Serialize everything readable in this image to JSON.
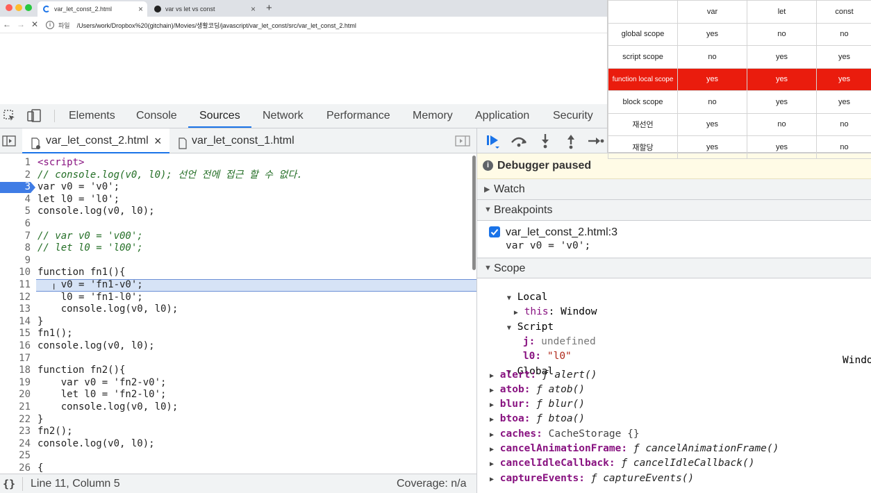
{
  "browser": {
    "tabs": [
      {
        "title": "var_let_const_2.html",
        "active": true
      },
      {
        "title": "var vs let vs const",
        "active": false
      }
    ],
    "new_tab": "+",
    "address_prefix": "파일",
    "url": "/Users/work/Dropbox%20(gitchain)/Movies/생활코딩/javascript/var_let_const/src/var_let_const_2.html"
  },
  "devtools": {
    "tabs": [
      "Elements",
      "Console",
      "Sources",
      "Network",
      "Performance",
      "Memory",
      "Application",
      "Security"
    ],
    "active_tab": "Sources"
  },
  "sources": {
    "files": [
      {
        "name": "var_let_const_2.html",
        "active": true
      },
      {
        "name": "var_let_const_1.html",
        "active": false
      }
    ]
  },
  "code": {
    "current_line": 3,
    "selected_line": 11,
    "lines": [
      "<script>",
      "// console.log(v0, l0); 선언 전에 접근 할 수 없다.",
      "var v0 = 'v0';",
      "let l0 = 'l0';",
      "console.log(v0, l0);",
      "",
      "// var v0 = 'v00';",
      "// let l0 = 'l00';",
      "",
      "function fn1(){",
      "    v0 = 'fn1-v0';",
      "    l0 = 'fn1-l0';",
      "    console.log(v0, l0);",
      "}",
      "fn1();",
      "console.log(v0, l0);",
      "",
      "function fn2(){",
      "    var v0 = 'fn2-v0';",
      "    let l0 = 'fn2-l0';",
      "    console.log(v0, l0);",
      "}",
      "fn2();",
      "console.log(v0, l0);",
      "",
      "{"
    ]
  },
  "status": {
    "braces": "{}",
    "position": "Line 11, Column 5",
    "coverage": "Coverage: n/a"
  },
  "debugger": {
    "paused_label": "Debugger paused",
    "watch_label": "Watch",
    "breakpoints_label": "Breakpoints",
    "breakpoint": {
      "location": "var_let_const_2.html:3",
      "code": "var v0 = 'v0';",
      "checked": true
    },
    "scope_label": "Scope",
    "local_label": "Local",
    "local_this_name": "this",
    "local_this_value": "Window",
    "script_label": "Script",
    "script_vars": [
      {
        "name": "j",
        "value": "undefined"
      },
      {
        "name": "l0",
        "value": "\"l0\""
      }
    ],
    "global_label": "Global",
    "global_value": "Windo",
    "globals": [
      {
        "name": "alert",
        "value": "alert()"
      },
      {
        "name": "atob",
        "value": "atob()"
      },
      {
        "name": "blur",
        "value": "blur()"
      },
      {
        "name": "btoa",
        "value": "btoa()"
      },
      {
        "name": "caches",
        "value": "CacheStorage {}"
      },
      {
        "name": "cancelAnimationFrame",
        "value": "cancelAnimationFrame()"
      },
      {
        "name": "cancelIdleCallback",
        "value": "cancelIdleCallback()"
      },
      {
        "name": "captureEvents",
        "value": "captureEvents()"
      }
    ],
    "fn_symbol": "ƒ"
  },
  "overlay_table": {
    "headers": [
      "",
      "var",
      "let",
      "const"
    ],
    "rows": [
      {
        "label": "global scope",
        "values": [
          "yes",
          "no",
          "no"
        ],
        "highlight": false
      },
      {
        "label": "script scope",
        "values": [
          "no",
          "yes",
          "yes"
        ],
        "highlight": false
      },
      {
        "label": "function local scope",
        "values": [
          "yes",
          "yes",
          "yes"
        ],
        "highlight": true
      },
      {
        "label": "block scope",
        "values": [
          "no",
          "yes",
          "yes"
        ],
        "highlight": false
      },
      {
        "label": "재선언",
        "values": [
          "yes",
          "no",
          "no"
        ],
        "highlight": false
      },
      {
        "label": "재할당",
        "values": [
          "yes",
          "yes",
          "no"
        ],
        "highlight": false
      }
    ]
  },
  "colors": {
    "accent": "#1a73e8",
    "highlight_row": "#ea1c0d",
    "paused_bg": "#fffbe6"
  }
}
